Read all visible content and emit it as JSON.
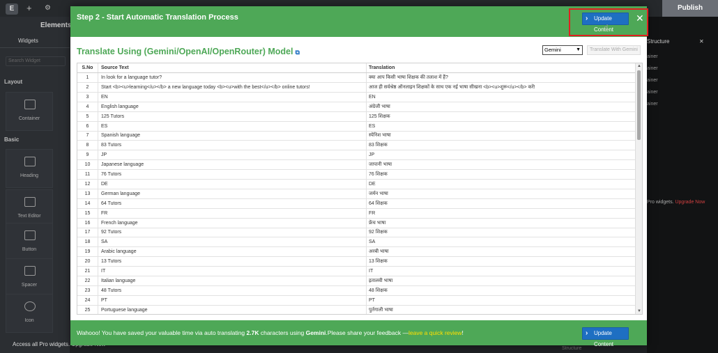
{
  "editor": {
    "panel_title": "Elements",
    "tab_widgets": "Widgets",
    "search_placeholder": "Search Widget",
    "section_layout": "Layout",
    "section_basic": "Basic",
    "widgets": [
      "Container",
      "Heading",
      "Text Editor",
      "Button",
      "Spacer",
      "Icon"
    ],
    "publish_label": "Publish",
    "structure_title": "Structure",
    "structure_items": [
      "ainer",
      "ainer",
      "ainer",
      "ainer",
      "ainer"
    ],
    "pro_text": "Pro widgets.",
    "pro_link": "Upgrade Now",
    "bottom_note": "Access all Pro widgets. Upgrade Now",
    "bottom_note2": "Structure"
  },
  "modal": {
    "title": "Step 2 - Start Automatic Translation Process",
    "update_label": "Update Content",
    "close_icon": "close-icon",
    "subtitle": "Translate Using (Gemini/OpenAI/OpenRouter) Model",
    "model_selected": "Gemini",
    "translate_button": "Translate With Gemini",
    "table": {
      "headers": [
        "S.No",
        "Source Text",
        "Translation"
      ],
      "rows": [
        [
          "1",
          "In look for a language tutor?",
          "क्या आप किसी भाषा शिक्षक की तलाश में हैं?"
        ],
        [
          "2",
          "Start <b><u>learning</u></b> a new language today <b><u>with the best</u></b> online tutors!",
          "आज ही सर्वश्रेष्ठ ऑनलाइन शिक्षकों के साथ एक नई भाषा सीखना <b><u>शुरू</u></b> करें!"
        ],
        [
          "3",
          "EN",
          "EN"
        ],
        [
          "4",
          "English language",
          "अंग्रेजी भाषा"
        ],
        [
          "5",
          "125 Tutors",
          "125 शिक्षक"
        ],
        [
          "6",
          "ES",
          "ES"
        ],
        [
          "7",
          "Spanish language",
          "स्पेनिश भाषा"
        ],
        [
          "8",
          "83 Tutors",
          "83 शिक्षक"
        ],
        [
          "9",
          "JP",
          "JP"
        ],
        [
          "10",
          "Japanese language",
          "जापानी भाषा"
        ],
        [
          "11",
          "76 Tutors",
          "76 शिक्षक"
        ],
        [
          "12",
          "DE",
          "DE"
        ],
        [
          "13",
          "German language",
          "जर्मन भाषा"
        ],
        [
          "14",
          "64 Tutors",
          "64 शिक्षक"
        ],
        [
          "15",
          "FR",
          "FR"
        ],
        [
          "16",
          "French language",
          "फ्रेंच भाषा"
        ],
        [
          "17",
          "92 Tutors",
          "92 शिक्षक"
        ],
        [
          "18",
          "SA",
          "SA"
        ],
        [
          "19",
          "Arabic language",
          "अरबी भाषा"
        ],
        [
          "20",
          "13 Tutors",
          "13 शिक्षक"
        ],
        [
          "21",
          "IT",
          "IT"
        ],
        [
          "22",
          "Italian language",
          "इतालवी भाषा"
        ],
        [
          "23",
          "48 Tutors",
          "48 शिक्षक"
        ],
        [
          "24",
          "PT",
          "PT"
        ],
        [
          "25",
          "Portuguese language",
          "पुर्तगाली भाषा"
        ]
      ]
    },
    "footer": {
      "text_before": "Wahooo! You have saved your valuable time via auto translating ",
      "chars": "2.7K",
      "text_mid": " characters using ",
      "model": "Gemini",
      "text_after": ".Please share your feedback —",
      "review_link": "leave a quick review",
      "text_end": "!"
    }
  }
}
